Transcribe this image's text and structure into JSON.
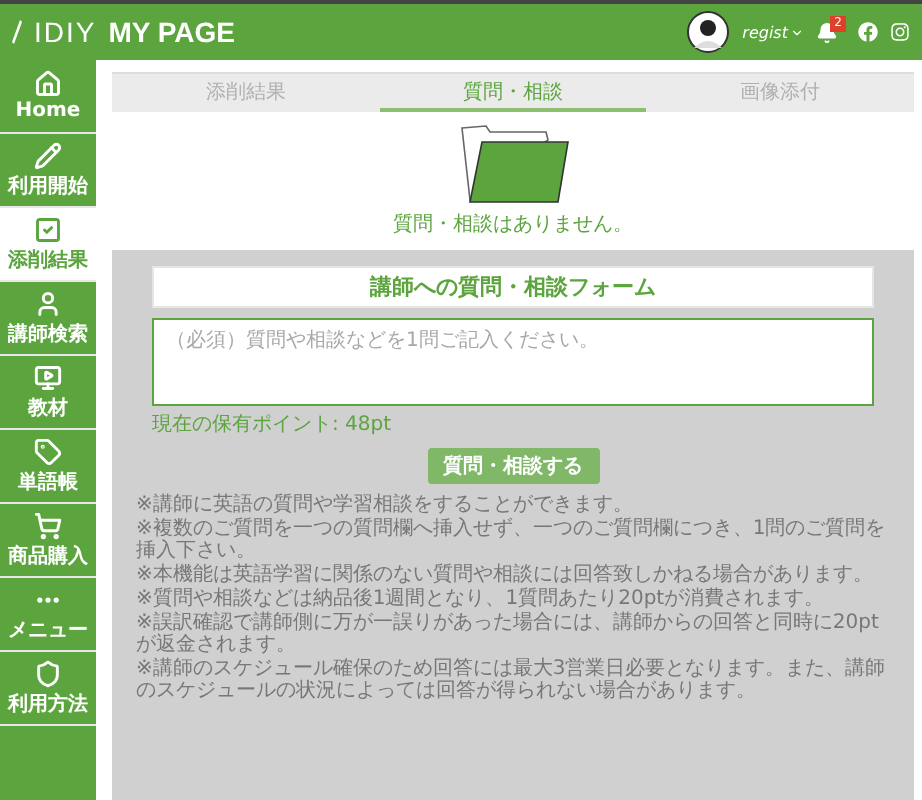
{
  "header": {
    "logo": "IDIY",
    "title": "MY PAGE",
    "user": "regist",
    "notification_count": "2"
  },
  "sidebar": {
    "items": [
      {
        "label": "Home",
        "selected": false
      },
      {
        "label": "利用開始",
        "selected": false
      },
      {
        "label": "添削結果",
        "selected": true
      },
      {
        "label": "講師検索",
        "selected": false
      },
      {
        "label": "教材",
        "selected": false
      },
      {
        "label": "単語帳",
        "selected": false
      },
      {
        "label": "商品購入",
        "selected": false
      },
      {
        "label": "メニュー",
        "selected": false
      },
      {
        "label": "利用方法",
        "selected": false
      }
    ]
  },
  "tabs": [
    {
      "label": "添削結果",
      "selected": false
    },
    {
      "label": "質問・相談",
      "selected": true
    },
    {
      "label": "画像添付",
      "selected": false
    }
  ],
  "empty_message": "質問・相談はありません。",
  "form": {
    "title": "講師への質問・相談フォーム",
    "placeholder": "（必須）質問や相談などを1問ご記入ください。",
    "points": "現在の保有ポイント: 48pt",
    "submit": "質問・相談する",
    "notes": [
      "※講師に英語の質問や学習相談をすることができます。",
      "※複数のご質問を一つの質問欄へ挿入せず、一つのご質問欄につき、1問のご質問を挿入下さい。",
      "※本機能は英語学習に関係のない質問や相談には回答致しかねる場合があります。",
      "※質問や相談などは納品後1週間となり、1質問あたり20ptが消費されます。",
      "※誤訳確認で講師側に万が一誤りがあった場合には、講師からの回答と同時に20ptが返金されます。",
      "※講師のスケジュール確保のため回答には最大3営業日必要となります。また、講師のスケジュールの状況によっては回答が得られない場合があります。"
    ]
  }
}
